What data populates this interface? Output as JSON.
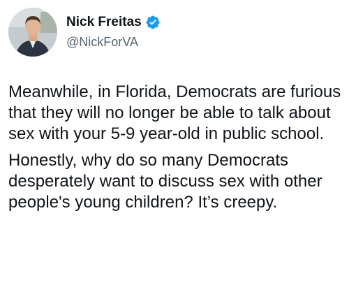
{
  "author": {
    "display_name": "Nick Freitas",
    "handle": "@NickForVA",
    "verified": true,
    "avatar_icon": "profile-photo",
    "verified_icon": "verified-badge-icon"
  },
  "tweet": {
    "paragraphs": [
      "Meanwhile, in Florida, Democrats are furious that they will no longer be able to talk about sex with your 5-9 year-old in public school.",
      "Honestly, why do so many Democrats desperately want to discuss sex with other people's young children? It’s creepy."
    ]
  },
  "colors": {
    "text": "#0f1419",
    "secondary_text": "#536471",
    "verified_blue": "#1d9bf0",
    "background": "#ffffff"
  }
}
